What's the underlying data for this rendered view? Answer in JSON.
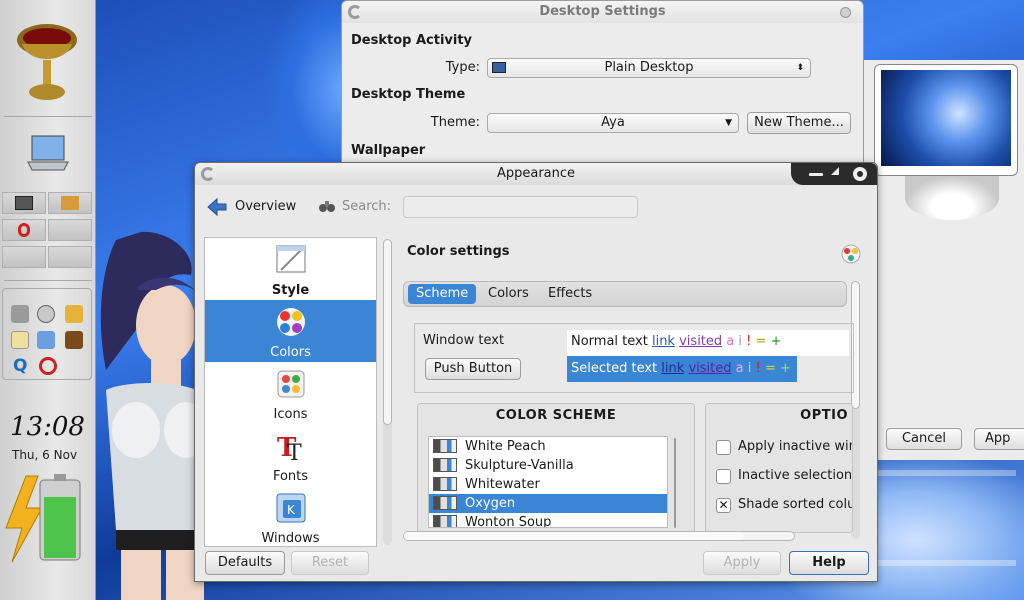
{
  "desktop_settings": {
    "title": "Desktop Settings",
    "activity_section": "Desktop Activity",
    "type_label": "Type:",
    "type_value": "Plain Desktop",
    "theme_section": "Desktop Theme",
    "theme_label": "Theme:",
    "theme_value": "Aya",
    "new_theme_button": "New Theme...",
    "wallpaper_section": "Wallpaper",
    "cancel_button": "Cancel",
    "apply_button": "App"
  },
  "panel": {
    "clock_time": "13:08",
    "clock_date": "Thu, 6 Nov",
    "battery_fill": 0.8
  },
  "appearance": {
    "title": "Appearance",
    "overview_label": "Overview",
    "search_label": "Search:",
    "search_value": "",
    "categories": [
      {
        "label": "Style",
        "icon": "style-icon"
      },
      {
        "label": "Colors",
        "icon": "colors-icon"
      },
      {
        "label": "Icons",
        "icon": "icons-icon"
      },
      {
        "label": "Fonts",
        "icon": "fonts-icon"
      },
      {
        "label": "Windows",
        "icon": "windows-icon"
      }
    ],
    "selected_category": "Colors",
    "page_title": "Color settings",
    "tabs": [
      "Scheme",
      "Colors",
      "Effects"
    ],
    "selected_tab": "Scheme",
    "preview": {
      "window_text": "Window text",
      "push_button": "Push Button",
      "normal_text": "Normal text",
      "selected_text": "Selected text",
      "link": "link",
      "visited": "visited",
      "a": "a",
      "i": "i",
      "excl": "!",
      "eq": "=",
      "plus": "+"
    },
    "color_scheme_title": "COLOR SCHEME",
    "schemes": [
      "White Peach",
      "Skulpture-Vanilla",
      "Whitewater",
      "Oxygen",
      "Wonton Soup"
    ],
    "selected_scheme": "Oxygen",
    "options_title": "OPTIO",
    "options": [
      {
        "label": "Apply inactive win",
        "checked": false
      },
      {
        "label": "Inactive selection",
        "checked": false
      },
      {
        "label": "Shade sorted colu",
        "checked": true
      }
    ],
    "defaults_button": "Defaults",
    "reset_button": "Reset",
    "apply_button": "Apply",
    "help_button": "Help"
  },
  "colors": {
    "selection": "#3b86d4",
    "window_bg": "#e9e9e9"
  }
}
